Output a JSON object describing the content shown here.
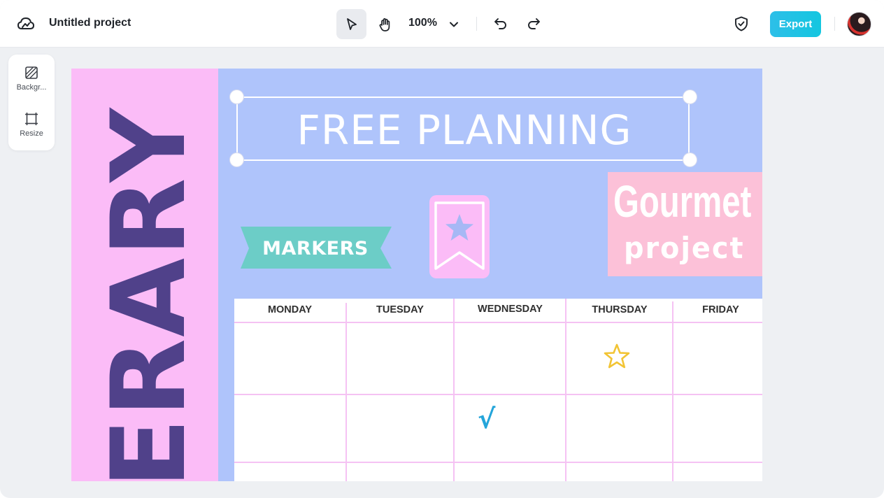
{
  "header": {
    "project_title": "Untitled project",
    "zoom": "100%",
    "export_label": "Export"
  },
  "sidebar": {
    "items": [
      {
        "label": "Backgr...",
        "icon": "background-icon"
      },
      {
        "label": "Resize",
        "icon": "resize-icon"
      }
    ]
  },
  "canvas": {
    "vertical_word": "ERARY",
    "headline": "FREE PLANNING",
    "ribbon_label": "MARKERS",
    "gourmet_line1": "Gourmet",
    "gourmet_line2": "project",
    "calendar": {
      "days": [
        "MONDAY",
        "TUESDAY",
        "WEDNESDAY",
        "THURSDAY",
        "FRIDAY"
      ],
      "check_mark": "√"
    }
  },
  "colors": {
    "accent": "#14c6e0",
    "canvas_bg": "#afc4fb",
    "pink_band": "#fbbcf7",
    "vertical_text": "#50418a",
    "ribbon": "#6ccdc7",
    "gourmet_bg": "#fcc1d8",
    "grid": "#f5c2f3",
    "star": "#f2c434",
    "check": "#24a5da"
  }
}
